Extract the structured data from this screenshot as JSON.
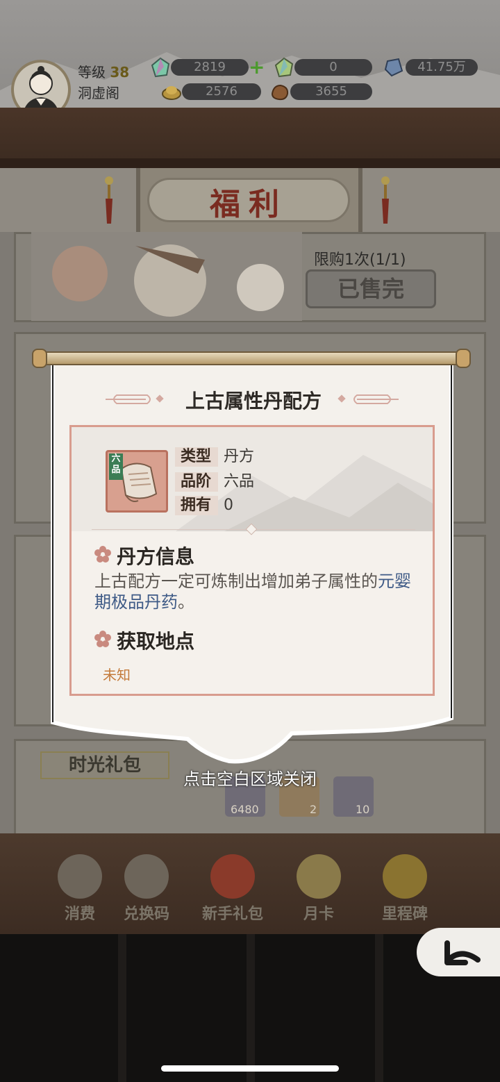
{
  "player": {
    "level_label": "等级",
    "level": "38",
    "sect": "洞虚阁"
  },
  "resources": {
    "spirit_stone": "2819",
    "spirit_stone_bound": "0",
    "crystal": "41.75万",
    "gold": "2576",
    "material": "3655"
  },
  "header": {
    "title": "福利"
  },
  "shop": {
    "limit": "限购1次(1/1)",
    "sold_out": "已售完",
    "pack_name": "时光礼包",
    "pack_items": [
      "6480",
      "2",
      "10"
    ]
  },
  "tabs": [
    {
      "label": "消费",
      "icon": "consume-icon"
    },
    {
      "label": "兑换码",
      "icon": "redeem-code-icon"
    },
    {
      "label": "新手礼包",
      "icon": "newbie-gift-icon"
    },
    {
      "label": "月卡",
      "icon": "month-card-icon"
    },
    {
      "label": "里程碑",
      "icon": "milestone-icon"
    }
  ],
  "modal": {
    "title": "上古属性丹配方",
    "grade_tag": "六品",
    "type_key": "类型",
    "type_val": "丹方",
    "grade_key": "品阶",
    "grade_val": "六品",
    "own_key": "拥有",
    "own_val": "0",
    "info_title": "丹方信息",
    "desc_part1": "上古配方一定可炼制出增加弟子属性的",
    "desc_highlight": "元婴期极品丹药",
    "desc_part2": "。",
    "source_title": "获取地点",
    "source_value": "未知",
    "close_hint": "点击空白区域关闭"
  },
  "colors": {
    "accent_red": "#7a2b20",
    "frame_pink": "#d89c8e",
    "highlight_blue": "#3e5a86",
    "source_orange": "#c47a3a"
  }
}
